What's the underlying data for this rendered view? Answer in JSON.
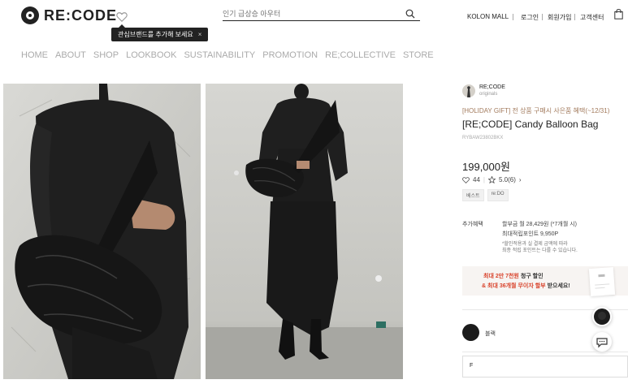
{
  "header": {
    "logo_text": "RE:CODE",
    "wishlist_tooltip": "관심브랜드를 추가해 보세요",
    "tooltip_close": "×",
    "search_placeholder": "인기 급상승 아우터",
    "util_links": [
      "KOLON MALL",
      "로그인",
      "회원가입",
      "고객센터"
    ]
  },
  "nav": {
    "items": [
      "HOME",
      "ABOUT",
      "SHOP",
      "LOOKBOOK",
      "SUSTAINABILITY",
      "PROMOTION",
      "RE;COLLECTIVE",
      "STORE"
    ]
  },
  "product": {
    "brand_name": "RE;CODE",
    "brand_sub": "originals",
    "promo": "[HOLIDAY GIFT] 전 상품 구매시 사은품 혜택(~12/31)",
    "title": "[RE;CODE] Candy Balloon Bag",
    "code": "RYBAW23802BKX",
    "price": "199,000원",
    "likes": "44",
    "rating": "5.0(6)",
    "rating_arrow": "›",
    "tags": [
      "베스트",
      "re:DO"
    ],
    "benefit_label": "추가혜택",
    "benefit_1": "할부금 월 28,429원 (*7개월 시)",
    "benefit_2": "최대적립포인트 9,950P",
    "benefit_note_1": "*할인적용과 실 결제 금액에 따라",
    "benefit_note_2": "최종 적립 포인트는 다를 수 있습니다.",
    "banner": {
      "l1_red": "최대 2만 7천원",
      "l1_bold": "청구 할인",
      "l2_red_a": "& 최대 36개월",
      "l2_red_b": "무이자 할부",
      "l2_rest": "받으세요!"
    },
    "color_label": "블랙",
    "size_label": "F"
  }
}
